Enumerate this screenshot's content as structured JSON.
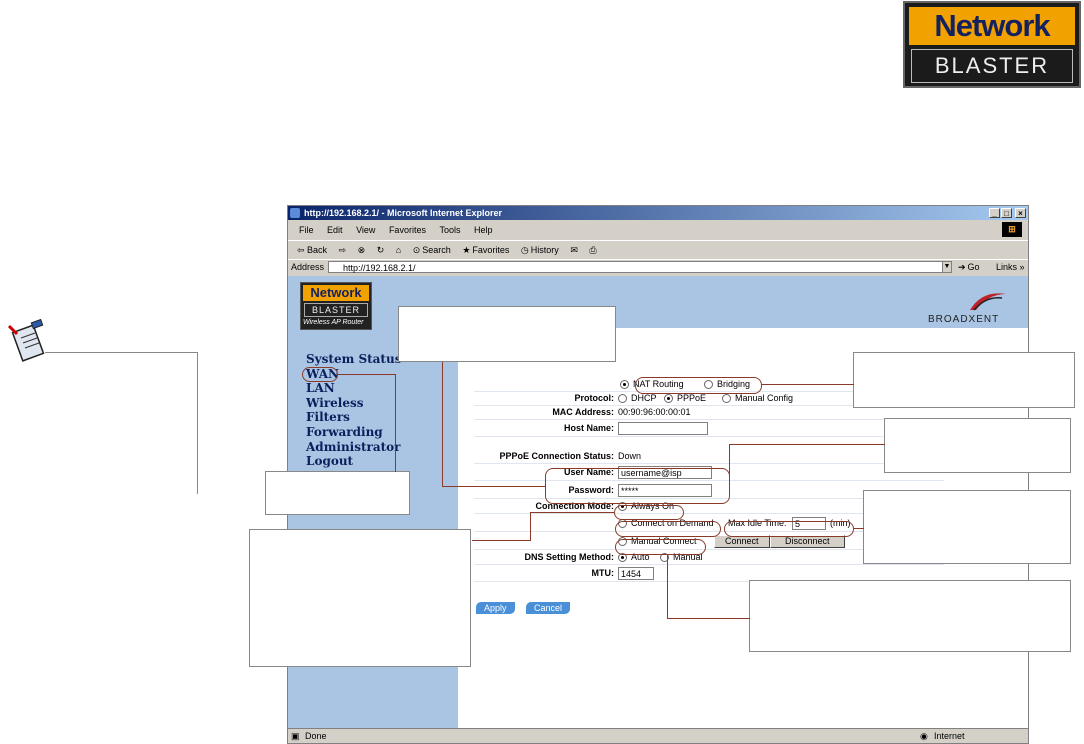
{
  "logo": {
    "line1": "Network",
    "line2": "BLASTER"
  },
  "browser": {
    "title": "http://192.168.2.1/ - Microsoft Internet Explorer",
    "window_buttons": [
      "_",
      "□",
      "×"
    ],
    "menu": [
      "File",
      "Edit",
      "View",
      "Favorites",
      "Tools",
      "Help"
    ],
    "toolbar": {
      "back": "⇦ Back",
      "forward": "⇨",
      "search": "Search",
      "favorites": "Favorites",
      "history": "History"
    },
    "address_label": "Address",
    "address_value": "http://192.168.2.1/",
    "go_label": "Go",
    "links_label": "Links »",
    "status_text": "Done",
    "zone_text": "Internet"
  },
  "page": {
    "mini_logo": {
      "line1": "Network",
      "line2": "BLASTER",
      "line3": "Wireless AP Router"
    },
    "brand": "BROADXENT",
    "nav": [
      "System Status",
      "WAN",
      "LAN",
      "Wireless",
      "Filters",
      "Forwarding",
      "Administrator",
      "Logout"
    ],
    "mode_options": [
      "NAT Routing",
      "Bridging"
    ],
    "mode_selected": "NAT Routing",
    "protocol": {
      "label": "Protocol:",
      "options": [
        "DHCP",
        "PPPoE",
        "Manual Config"
      ],
      "selected": "PPPoE"
    },
    "mac": {
      "label": "MAC Address:",
      "value": "00:90:96:00:00:01"
    },
    "host": {
      "label": "Host Name:",
      "value": ""
    },
    "pppoe_status": {
      "label": "PPPoE Connection Status:",
      "value": "Down"
    },
    "username": {
      "label": "User Name:",
      "value": "username@isp"
    },
    "password": {
      "label": "Password:",
      "value": "*****"
    },
    "connection_mode": {
      "label": "Connection Mode:",
      "always_on": "Always On",
      "on_demand": "Connect on Demand",
      "max_idle_label": "Max Idle Time:",
      "max_idle_value": "5",
      "max_idle_unit": "(min)",
      "manual": "Manual Connect",
      "connect": "Connect",
      "disconnect": "Disconnect",
      "selected": "Always On"
    },
    "dns": {
      "label": "DNS Setting Method:",
      "options": [
        "Auto",
        "Manual"
      ],
      "selected": "Auto"
    },
    "mtu": {
      "label": "MTU:",
      "value": "1454"
    },
    "apply": "Apply",
    "cancel": "Cancel"
  },
  "colors": {
    "annotation": "#8b3a2a",
    "nav_bg": "#a9c5e3",
    "nav_text": "#0a1f5c",
    "logo_orange": "#f2a200"
  }
}
